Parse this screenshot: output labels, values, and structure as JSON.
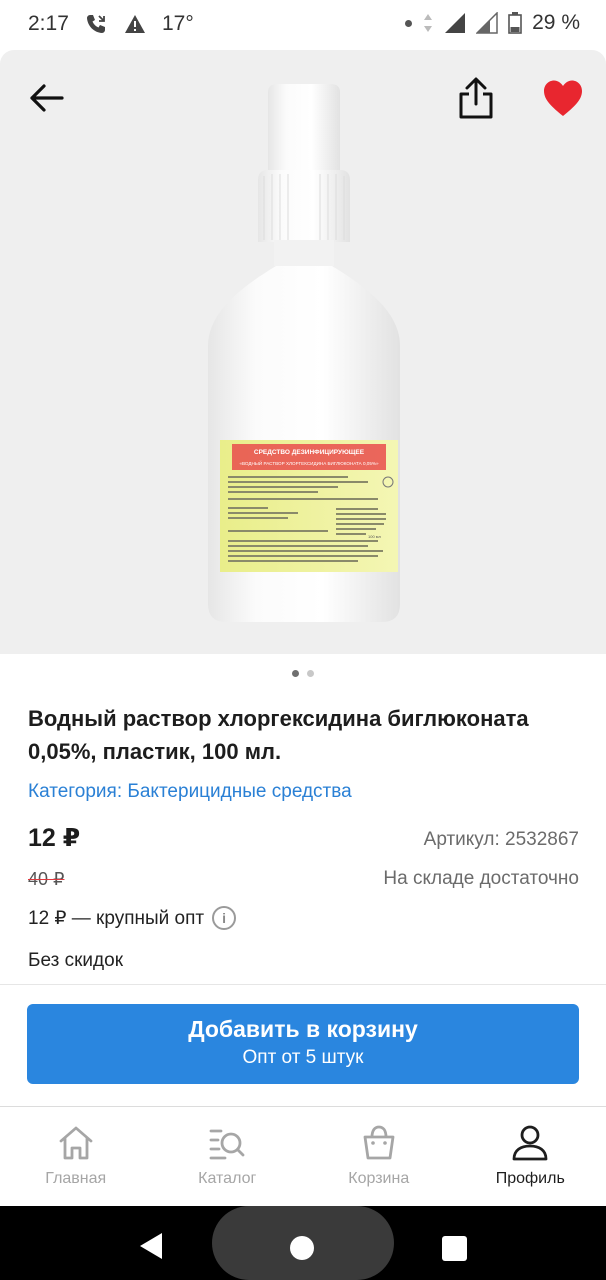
{
  "status_bar": {
    "time": "2:17",
    "temperature": "17°",
    "battery": "29 %"
  },
  "product": {
    "title": "Водный раствор хлоргексидина биглюконата 0,05%, пластик, 100 мл.",
    "category": "Категория: Бактерицидные средства",
    "price": "12 ₽",
    "article": "Артикул: 2532867",
    "old_price": "40 ₽",
    "stock": "На складе достаточно",
    "wholesale": "12 ₽ — крупный опт",
    "discount": "Без скидок",
    "image_count": 2,
    "active_image": 1
  },
  "label": {
    "heading": "СРЕДСТВО ДЕЗИНФИЦИРУЮЩЕЕ",
    "subheading": "«ВОДНЫЙ РАСТВОР ХЛОРГЕКСИДИНА БИГЛЮКОНАТА 0,05%»",
    "volume": "100 мл"
  },
  "cart_button": {
    "label": "Добавить в корзину",
    "sublabel": "Опт от 5 штук"
  },
  "bottom_nav": [
    {
      "label": "Главная",
      "icon": "home-icon",
      "active": false
    },
    {
      "label": "Каталог",
      "icon": "catalog-search-icon",
      "active": false
    },
    {
      "label": "Корзина",
      "icon": "bag-icon",
      "active": false
    },
    {
      "label": "Профиль",
      "icon": "person-icon",
      "active": true
    }
  ],
  "colors": {
    "accent": "#2a86df",
    "link": "#2a80d5",
    "favorite": "#e8262f",
    "strike": "#e0383e"
  }
}
